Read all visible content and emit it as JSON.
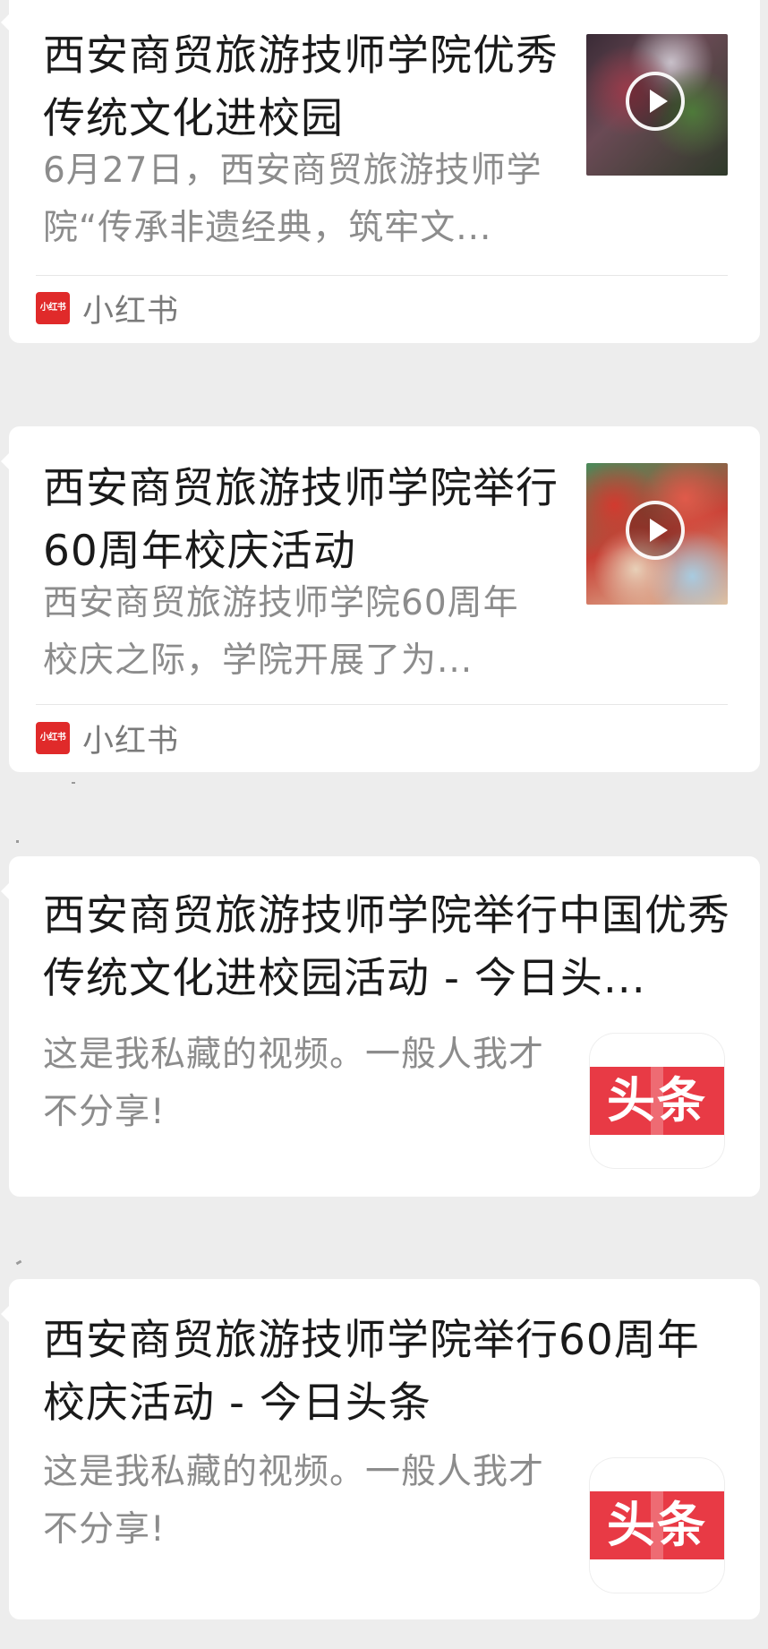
{
  "cards": [
    {
      "title": "西安商贸旅游技师学院优秀传统文化进校园",
      "description": "6月27日，西安商贸旅游技师学院“传承非遗经典，筑牢文...",
      "thumbnail": "video",
      "source": {
        "name": "小红书",
        "logo_text": "小红书"
      }
    },
    {
      "title": "西安商贸旅游技师学院举行60周年校庆活动",
      "description": "西安商贸旅游技师学院60周年校庆之际，学院开展了为...",
      "thumbnail": "video",
      "source": {
        "name": "小红书",
        "logo_text": "小红书"
      }
    },
    {
      "title": "西安商贸旅游技师学院举行中国优秀传统文化进校园活动 - 今日头...",
      "description": "这是我私藏的视频。一般人我才不分享!",
      "icon": {
        "name": "toutiao-app-icon",
        "text": "头条"
      }
    },
    {
      "title": "西安商贸旅游技师学院举行60周年校庆活动 - 今日头条",
      "description": "这是我私藏的视频。一般人我才不分享!",
      "icon": {
        "name": "toutiao-app-icon",
        "text": "头条"
      }
    }
  ],
  "colors": {
    "background": "#ededed",
    "card": "#ffffff",
    "title_text": "#1a1a1a",
    "desc_text": "#8c8c8c",
    "xiaohongshu_red": "#e02a2a",
    "toutiao_red": "#e83a45"
  }
}
